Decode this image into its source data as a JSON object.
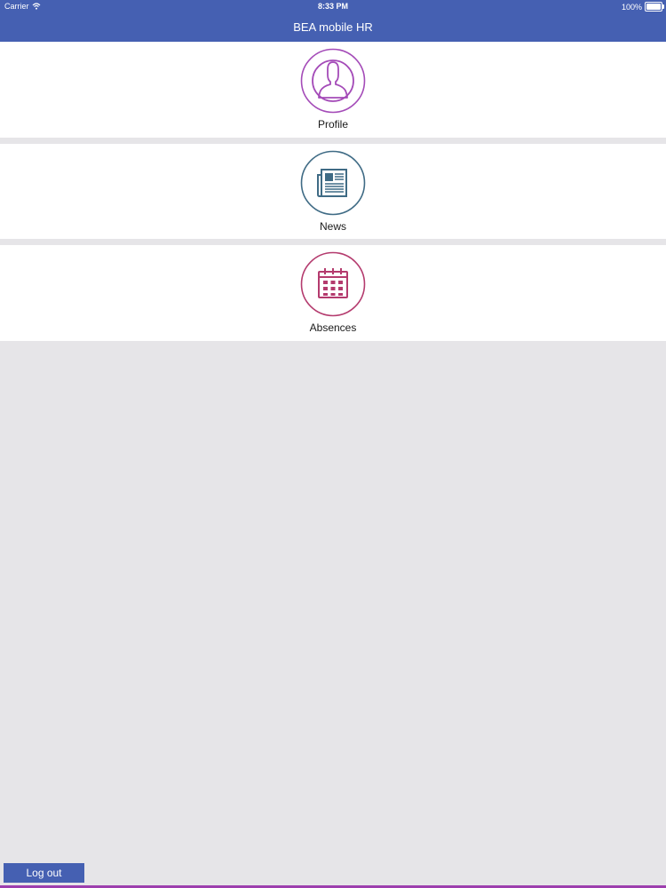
{
  "status_bar": {
    "carrier": "Carrier",
    "time": "8:33 PM",
    "battery": "100%",
    "battery_level": 1.0
  },
  "header": {
    "title": "BEA mobile HR",
    "color": "#4560b2"
  },
  "tiles": [
    {
      "label": "Profile",
      "icon": "person-icon",
      "color": "#a44bb8"
    },
    {
      "label": "News",
      "icon": "newspaper-icon",
      "color": "#3f6b85"
    },
    {
      "label": "Absences",
      "icon": "calendar-icon",
      "color": "#b43b6e"
    }
  ],
  "footer": {
    "logout_label": "Log out"
  }
}
